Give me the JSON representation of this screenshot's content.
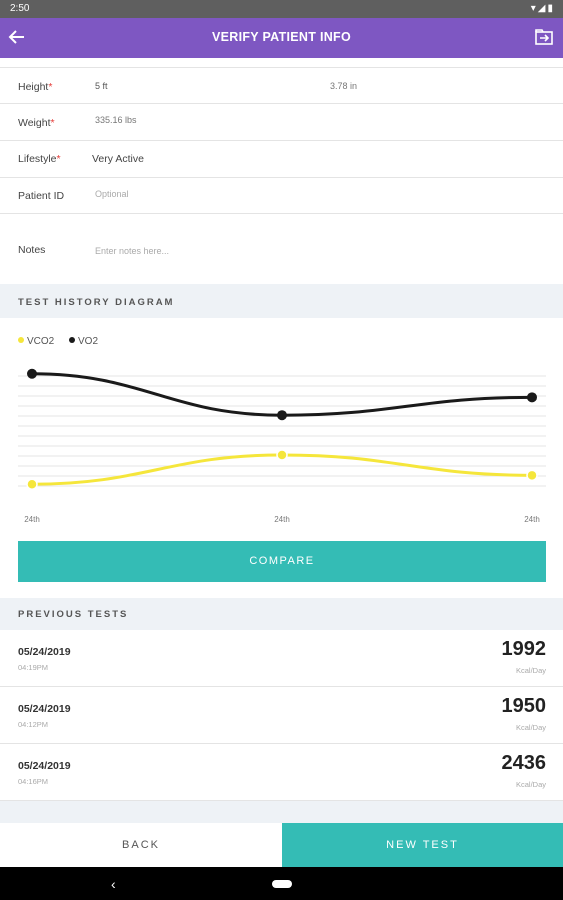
{
  "status_bar": {
    "time": "2:50",
    "icons": "▾◢▮"
  },
  "app_bar": {
    "title": "VERIFY PATIENT INFO",
    "back_icon": "arrow-left-icon",
    "action_icon": "export-icon"
  },
  "form": {
    "height": {
      "label": "Height",
      "required_mark": "*",
      "value_ft": "5 ft",
      "value_in": "3.78 in"
    },
    "weight": {
      "label": "Weight",
      "required_mark": "*",
      "value": "335.16 lbs"
    },
    "lifestyle": {
      "label": "Lifestyle",
      "required_mark": "*",
      "value": "Very Active"
    },
    "patient_id": {
      "label": "Patient ID",
      "placeholder": "Optional"
    },
    "notes": {
      "label": "Notes",
      "placeholder": "Enter notes here..."
    }
  },
  "test_history": {
    "section_title": "TEST HISTORY DIAGRAM"
  },
  "chart_data": {
    "type": "line",
    "categories": [
      "24th",
      "24th",
      "24th"
    ],
    "series": [
      {
        "name": "VCO2",
        "values": [
          0.12,
          0.48,
          0.23
        ],
        "color": "#f5e63b"
      },
      {
        "name": "VO2",
        "values": [
          1.48,
          0.97,
          1.19
        ],
        "color": "#1a1a1a"
      }
    ],
    "ylim": [
      0,
      1.6
    ],
    "grid": true,
    "legend": "top-left"
  },
  "compare_label": "COMPARE",
  "previous_tests": {
    "section_title": "PREVIOUS TESTS",
    "rows": [
      {
        "date": "05/24/2019",
        "time": "04:19PM",
        "value": "1992",
        "unit": "Kcal/Day"
      },
      {
        "date": "05/24/2019",
        "time": "04:12PM",
        "value": "1950",
        "unit": "Kcal/Day"
      },
      {
        "date": "05/24/2019",
        "time": "04:16PM",
        "value": "2436",
        "unit": "Kcal/Day"
      }
    ]
  },
  "bottom": {
    "back_label": "BACK",
    "new_test_label": "NEW TEST"
  },
  "nav": {
    "back_glyph": "‹"
  }
}
